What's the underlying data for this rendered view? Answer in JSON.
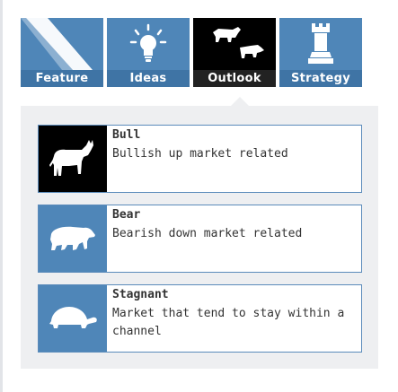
{
  "tabs": [
    {
      "label": "Feature",
      "icon": "feature-beam-icon",
      "active": false
    },
    {
      "label": "Ideas",
      "icon": "lightbulb-icon",
      "active": false
    },
    {
      "label": "Outlook",
      "icon": "bull-bear-icon",
      "active": true
    },
    {
      "label": "Strategy",
      "icon": "rook-icon",
      "active": false
    }
  ],
  "cards": [
    {
      "title": "Bull",
      "description": "Bullish up market related",
      "icon": "bull-icon"
    },
    {
      "title": "Bear",
      "description": "Bearish down market related",
      "icon": "bear-icon"
    },
    {
      "title": "Stagnant",
      "description": "Market that tend to stay within a channel",
      "icon": "turtle-icon"
    }
  ],
  "colors": {
    "tab_blue": "#4f86b8",
    "tab_label_blue": "#3f74a5",
    "active_tab": "#000000",
    "panel_bg": "#eeeff1",
    "card_border": "#5b8bbb",
    "text": "#333333"
  }
}
